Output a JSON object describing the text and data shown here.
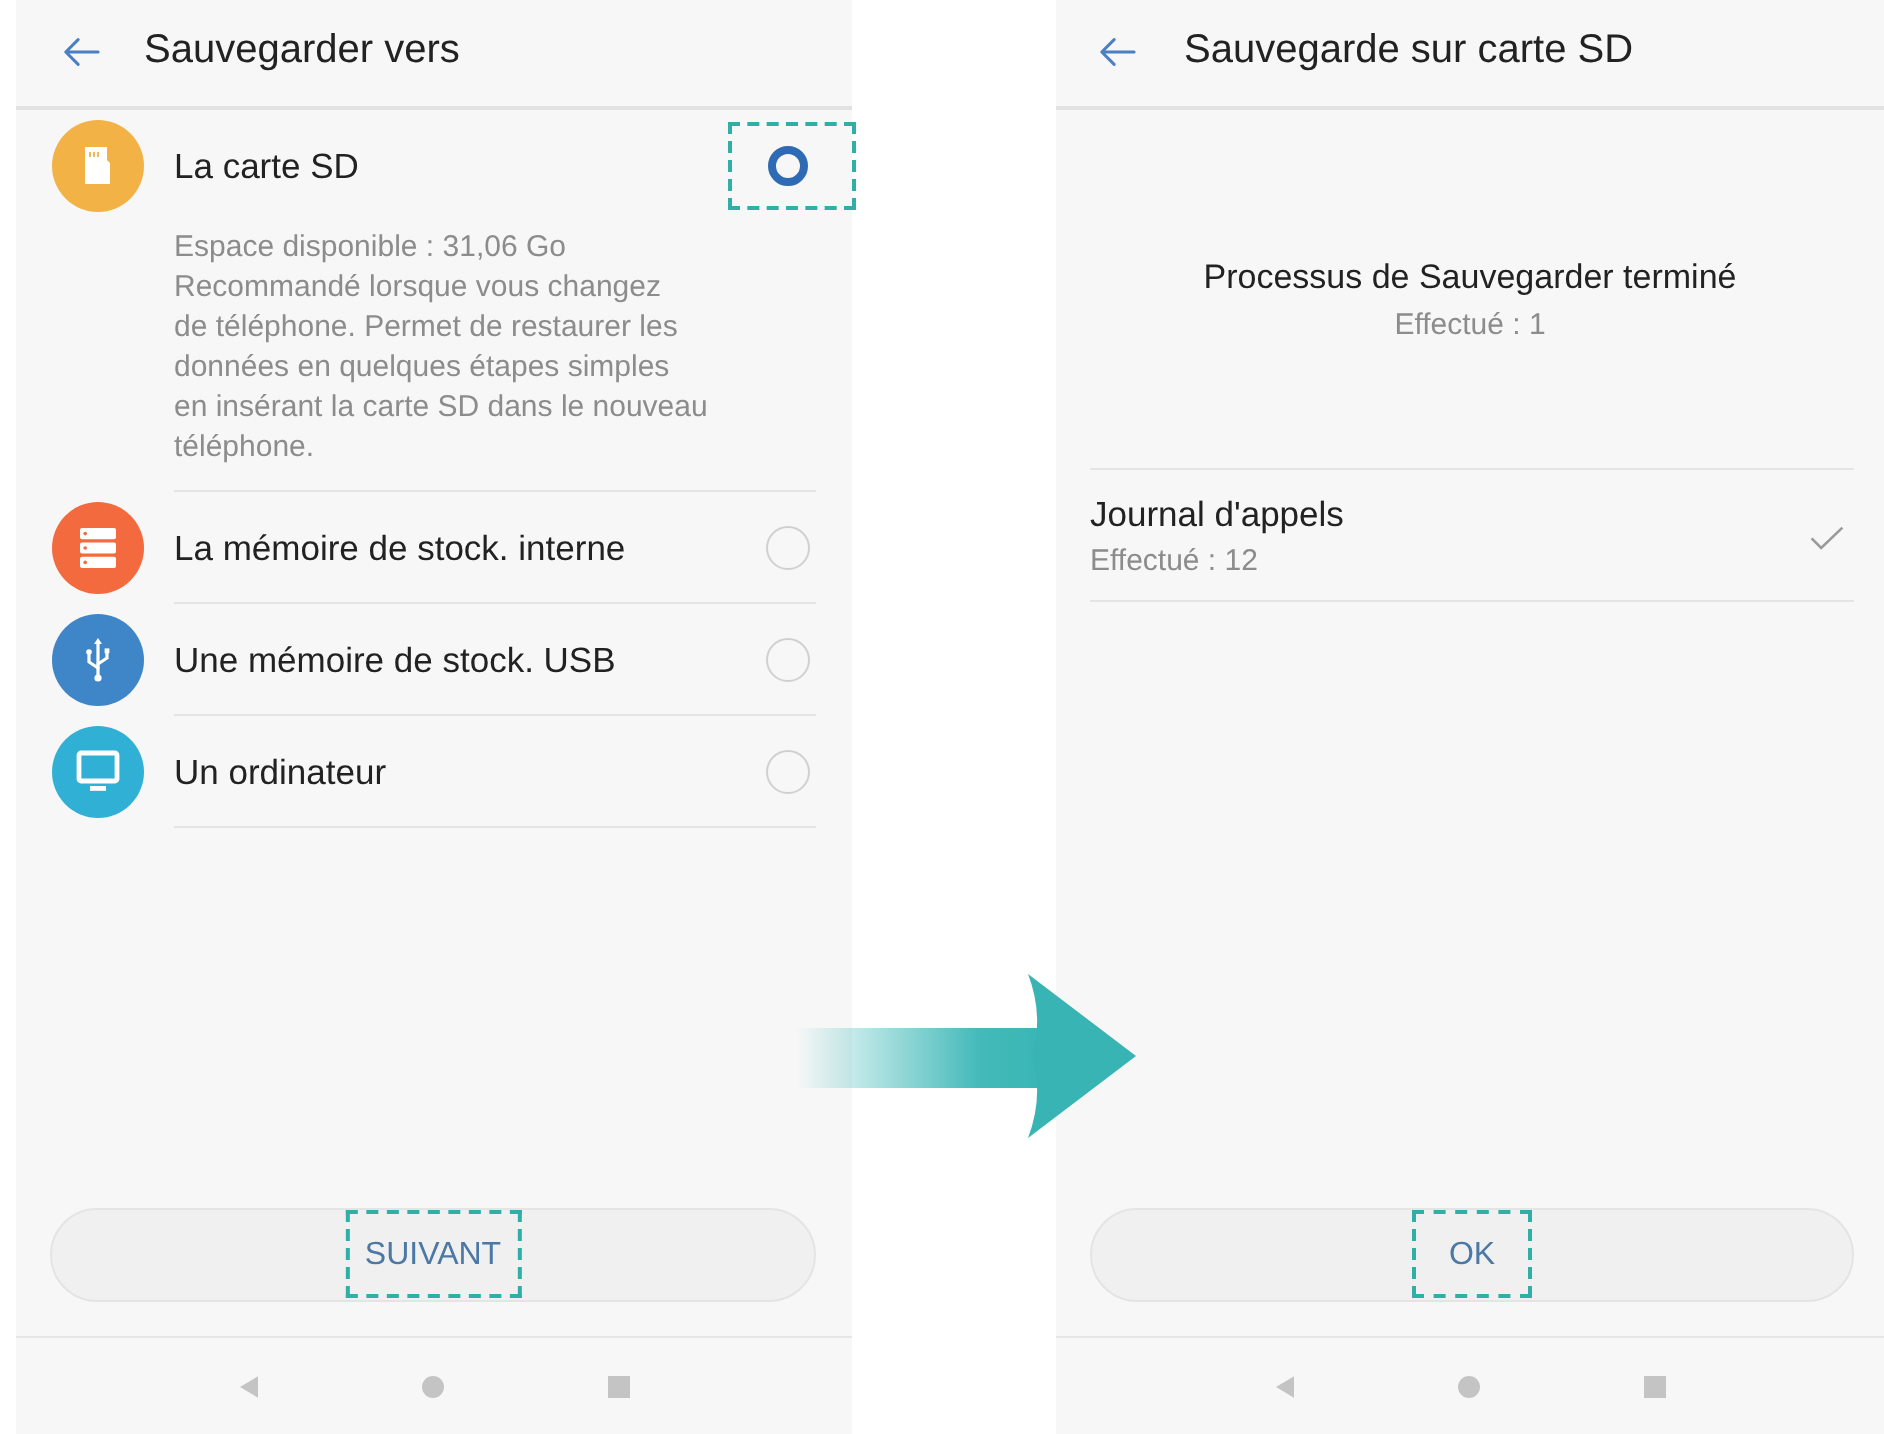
{
  "destination_screen": {
    "title": "Sauvegarder vers",
    "options": [
      {
        "kind": "sd-card",
        "label": "La carte SD",
        "color": "#f2b246",
        "selected": true,
        "highlighted": true,
        "details": [
          "Espace disponible : 31,06 Go",
          "Recommandé lorsque vous changez\nde téléphone. Permet de restaurer les\ndonnées en quelques étapes simples\nen insérant la carte SD dans le nouveau\ntéléphone."
        ]
      },
      {
        "kind": "internal-storage",
        "label": "La mémoire de stock. interne",
        "color": "#f26a3d",
        "selected": false,
        "highlighted": false
      },
      {
        "kind": "usb",
        "label": "Une mémoire de stock. USB",
        "color": "#3e86c8",
        "selected": false,
        "highlighted": false
      },
      {
        "kind": "computer",
        "label": "Un ordinateur",
        "color": "#2fb0d4",
        "selected": false,
        "highlighted": false
      }
    ],
    "button": {
      "label": "SUIVANT",
      "highlighted": true
    }
  },
  "result_screen": {
    "title": "Sauvegarde sur carte SD",
    "status": "Processus de Sauvegarder terminé",
    "status_detail": "Effectué : 1",
    "items": [
      {
        "label": "Journal d'appels",
        "detail": "Effectué : 12",
        "checked": true
      }
    ],
    "button": {
      "label": "OK",
      "highlighted": true
    }
  }
}
